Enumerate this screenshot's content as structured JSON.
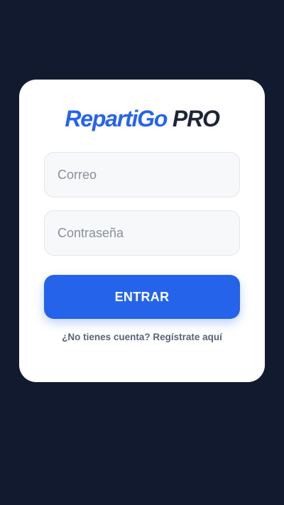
{
  "login": {
    "logo": {
      "brand": "RepartiGo",
      "suffix": "PRO"
    },
    "email_field": {
      "placeholder": "Correo",
      "value": ""
    },
    "password_field": {
      "placeholder": "Contraseña",
      "value": ""
    },
    "submit_label": "ENTRAR",
    "register_link": "¿No tienes cuenta? Regístrate aquí"
  },
  "colors": {
    "background": "#111a2e",
    "card": "#ffffff",
    "accent": "#2563eb",
    "logo_suffix": "#1e2535",
    "link_text": "#5a6374"
  }
}
